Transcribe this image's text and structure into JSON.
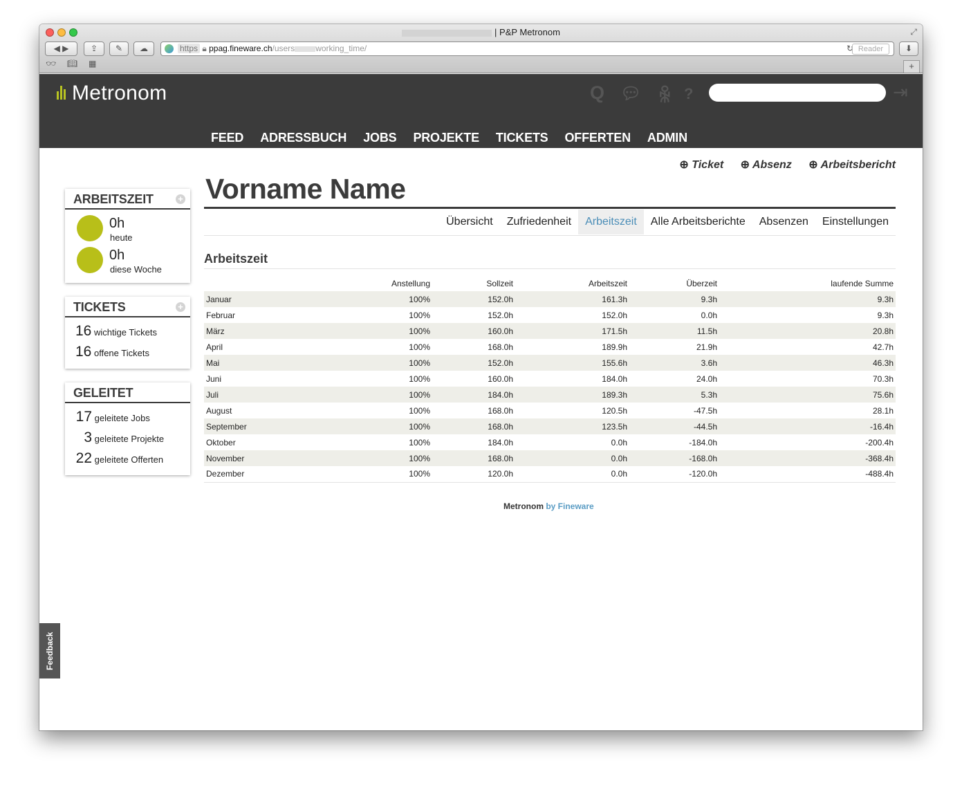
{
  "browser": {
    "title": "| P&P Metronom",
    "url_scheme": "https",
    "url_host": "ppag.fineware.ch",
    "url_path_a": "/users",
    "url_path_b": "working_time/",
    "reader_label": "Reader",
    "newtab_label": "+"
  },
  "header": {
    "logo": "Metronom",
    "search_placeholder": "",
    "nav": [
      "FEED",
      "ADRESSBUCH",
      "JOBS",
      "PROJEKTE",
      "TICKETS",
      "OFFERTEN",
      "ADMIN"
    ]
  },
  "actions": {
    "ticket": "Ticket",
    "absenz": "Absenz",
    "arbeitsbericht": "Arbeitsbericht"
  },
  "sidebar": {
    "arbeitszeit": {
      "title": "ARBEITSZEIT",
      "rows": [
        {
          "value": "0h",
          "label": "heute"
        },
        {
          "value": "0h",
          "label": "diese Woche"
        }
      ]
    },
    "tickets": {
      "title": "TICKETS",
      "rows": [
        {
          "value": "16",
          "label": "wichtige Tickets"
        },
        {
          "value": "16",
          "label": "offene Tickets"
        }
      ]
    },
    "geleitet": {
      "title": "GELEITET",
      "rows": [
        {
          "value": "17",
          "label": "geleitete Jobs"
        },
        {
          "value": "3",
          "label": "geleitete Projekte"
        },
        {
          "value": "22",
          "label": "geleitete Offerten"
        }
      ]
    }
  },
  "page_title": "Vorname Name",
  "subnav": [
    "Übersicht",
    "Zufriedenheit",
    "Arbeitszeit",
    "Alle Arbeitsberichte",
    "Absenzen",
    "Einstellungen"
  ],
  "subnav_active": "Arbeitszeit",
  "section_title": "Arbeitszeit",
  "table": {
    "headers": [
      "",
      "Anstellung",
      "Sollzeit",
      "Arbeitszeit",
      "Überzeit",
      "laufende Summe"
    ],
    "rows": [
      [
        "Januar",
        "100%",
        "152.0h",
        "161.3h",
        "9.3h",
        "9.3h"
      ],
      [
        "Februar",
        "100%",
        "152.0h",
        "152.0h",
        "0.0h",
        "9.3h"
      ],
      [
        "März",
        "100%",
        "160.0h",
        "171.5h",
        "11.5h",
        "20.8h"
      ],
      [
        "April",
        "100%",
        "168.0h",
        "189.9h",
        "21.9h",
        "42.7h"
      ],
      [
        "Mai",
        "100%",
        "152.0h",
        "155.6h",
        "3.6h",
        "46.3h"
      ],
      [
        "Juni",
        "100%",
        "160.0h",
        "184.0h",
        "24.0h",
        "70.3h"
      ],
      [
        "Juli",
        "100%",
        "184.0h",
        "189.3h",
        "5.3h",
        "75.6h"
      ],
      [
        "August",
        "100%",
        "168.0h",
        "120.5h",
        "-47.5h",
        "28.1h"
      ],
      [
        "September",
        "100%",
        "168.0h",
        "123.5h",
        "-44.5h",
        "-16.4h"
      ],
      [
        "Oktober",
        "100%",
        "184.0h",
        "0.0h",
        "-184.0h",
        "-200.4h"
      ],
      [
        "November",
        "100%",
        "168.0h",
        "0.0h",
        "-168.0h",
        "-368.4h"
      ],
      [
        "Dezember",
        "100%",
        "120.0h",
        "0.0h",
        "-120.0h",
        "-488.4h"
      ]
    ]
  },
  "footer": {
    "brand": "Metronom",
    "by": "by Fineware"
  },
  "feedback_label": "Feedback",
  "colors": {
    "header_bg": "#3b3b3b",
    "accent": "#b8bf19",
    "link": "#4a8db7"
  }
}
